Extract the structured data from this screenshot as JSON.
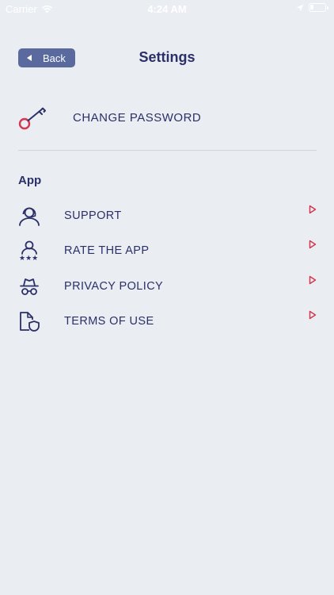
{
  "status_bar": {
    "carrier": "Carrier",
    "time": "4:24 AM"
  },
  "header": {
    "back_label": "Back",
    "title": "Settings"
  },
  "account": {
    "change_password_label": "CHANGE PASSWORD"
  },
  "app_section": {
    "title": "App",
    "items": [
      {
        "label": "SUPPORT",
        "icon": "support-agent-icon"
      },
      {
        "label": "RATE THE APP",
        "icon": "rate-stars-icon"
      },
      {
        "label": "PRIVACY POLICY",
        "icon": "incognito-icon"
      },
      {
        "label": "TERMS OF USE",
        "icon": "document-shield-icon"
      }
    ]
  },
  "colors": {
    "background": "#eaedf2",
    "text": "#2b3068",
    "back_button": "#5a6a9e",
    "accent": "#d3384f"
  }
}
